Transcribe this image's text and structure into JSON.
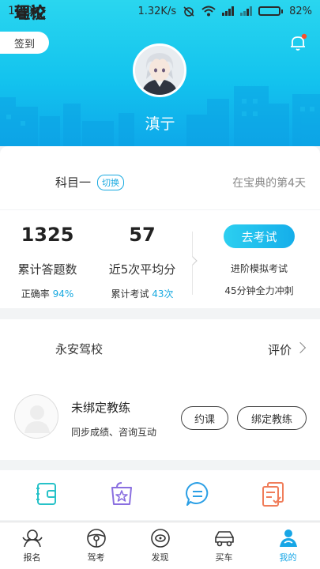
{
  "status_bar": {
    "time": "1:20",
    "speed": "1.32K/s",
    "battery": "82%",
    "battery_level": 0.82
  },
  "header": {
    "signin_label": "签到",
    "username": "滇亍",
    "bell_icon": "bell-icon",
    "notification_dot_color": "#f5502f"
  },
  "theory": {
    "title": "理论",
    "subject": "科目一",
    "switch_label": "切换",
    "day_note": "在宝典的第4天"
  },
  "stats": {
    "answered_count": "1325",
    "answered_label": "累计答题数",
    "accuracy_prefix": "正确率",
    "accuracy_value": "94%",
    "avg_score": "57",
    "avg_label": "近5次平均分",
    "exams_prefix": "累计考试",
    "exams_value": "43次",
    "exam_button": "去考试",
    "exam_note_1": "进阶模拟考试",
    "exam_note_2": "45分钟全力冲刺"
  },
  "school": {
    "title": "驾校",
    "name": "永安驾校",
    "rate_label": "评价",
    "coach_title": "未绑定教练",
    "coach_sub": "同步成绩、咨询互动",
    "book_button": "约课",
    "bind_button": "绑定教练"
  },
  "shortcuts": [
    "notebook-icon",
    "star-bag-icon",
    "chat-icon",
    "documents-icon"
  ],
  "nav": {
    "items": [
      {
        "label": "报名",
        "icon": "signup-icon"
      },
      {
        "label": "驾考",
        "icon": "steering-wheel-icon"
      },
      {
        "label": "发现",
        "icon": "discover-icon"
      },
      {
        "label": "买车",
        "icon": "car-icon"
      },
      {
        "label": "我的",
        "icon": "profile-icon"
      }
    ],
    "active_index": 4,
    "accent": "#17a6e6"
  }
}
